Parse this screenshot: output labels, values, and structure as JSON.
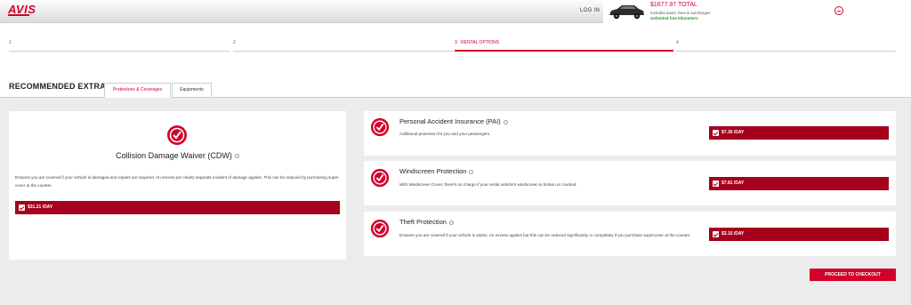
{
  "header": {
    "logo": "AVIS",
    "login": "LOG IN",
    "total": "$1677.97 TOTAL",
    "includes": "Includes taxes, fees & surcharges",
    "unlimited": "Unlimited free kilometers"
  },
  "steps": [
    {
      "num": "1",
      "label": ""
    },
    {
      "num": "2",
      "label": ""
    },
    {
      "num": "3",
      "label": "RENTAL OPTIONS"
    },
    {
      "num": "4",
      "label": ""
    }
  ],
  "extras": {
    "title": "RECOMMENDED EXTRAS",
    "tabs": [
      "Protections & Coverages",
      "Equipments"
    ]
  },
  "cdw": {
    "title": "Collision Damage Waiver (CDW)",
    "description": "Ensures you are covered if your vehicle is damaged and repairs are required. An excess per clearly separate incident of damage applies. This can be reduced by purchasing super cover at the counter.",
    "price": "$31.21 /DAY"
  },
  "items": [
    {
      "title": "Personal Accident Insurance (PAI)",
      "description": "Additional protection for you and your passengers.",
      "price": "$7.36 /DAY"
    },
    {
      "title": "Windscreen Protection",
      "description": "With Windscreen Cover, there's no charge if your rental vehicle's windscreen is broken or cracked.",
      "price": "$7.81 /DAY"
    },
    {
      "title": "Theft Protection",
      "description": "Ensures you are covered if your vehicle is stolen. An excess applies but this can be reduced significantly or completely if you purchase supercover at the counter.",
      "price": "$3.15 /DAY"
    }
  ],
  "checkout": "PROCEED TO CHECKOUT",
  "colors": {
    "brand": "#d4002a",
    "price_bar": "#a5001c",
    "free_km": "#2a9a2a"
  }
}
